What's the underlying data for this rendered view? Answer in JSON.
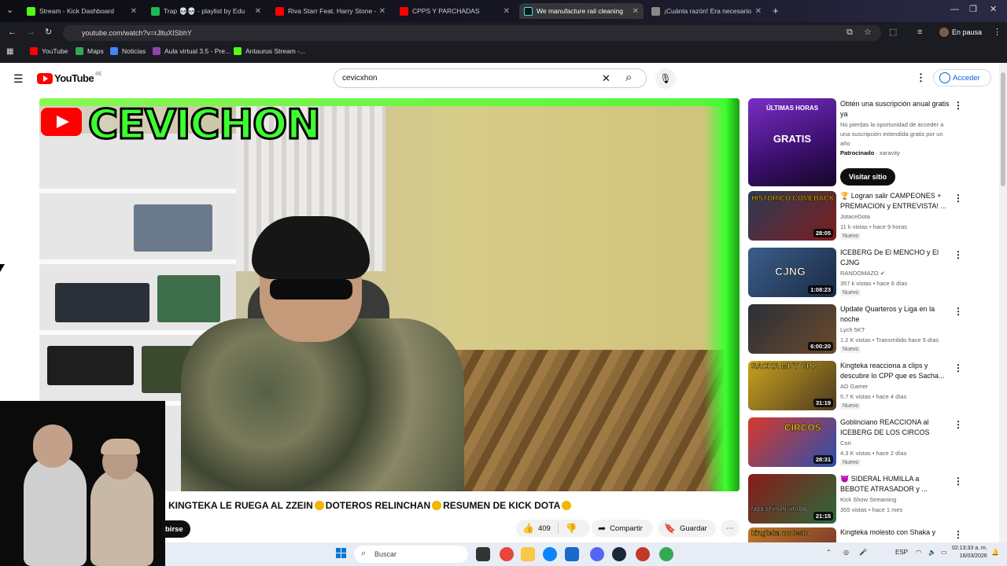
{
  "browser": {
    "tabs": [
      {
        "title": "Stream - Kick Dashboard",
        "color": "#53fc18"
      },
      {
        "title": "Trap 💀💀 - playlist by Edu",
        "color": "#1db954"
      },
      {
        "title": "Riva Starr Feat. Harry Stone - Hi",
        "color": "#ff0000"
      },
      {
        "title": "CPPS Y PARCHADAS",
        "color": "#ff0000"
      },
      {
        "title": "We manufacture rail cleaning",
        "color": "#111111"
      },
      {
        "title": "¡Cuánta razón! Era necesario p",
        "color": "#888888"
      }
    ],
    "url": "youtube.com/watch?v=rJltuXISbhY",
    "profile_label": "En pausa",
    "bookmarks": [
      {
        "label": "YouTube",
        "color": "#ff0000"
      },
      {
        "label": "Maps",
        "color": "#34a853"
      },
      {
        "label": "Noticias",
        "color": "#4285f4"
      },
      {
        "label": "Aula virtual 3.5 - Pre...",
        "color": "#8e44ad"
      },
      {
        "label": "Antaurus Stream -...",
        "color": "#53fc18"
      }
    ]
  },
  "youtube": {
    "logo_text": "YouTube",
    "region": "PE",
    "search_value": "cevicxhon",
    "signin_label": "Acceder"
  },
  "video": {
    "brand_overlay": "CEVICHON",
    "title_parts": [
      "KINGTEKA LE RUEGA AL ZZEIN",
      "DOTEROS RELINCHAN",
      "RESUMEN DE KICK DOTA"
    ],
    "subscribe_label": "birse",
    "likes": "409",
    "share_label": "Compartir",
    "save_label": "Guardar"
  },
  "ad": {
    "thumb_line1": "ÚLTIMAS HORAS",
    "thumb_line2": "GRATIS",
    "title": "Obtén una suscripción anual gratis ya",
    "desc": "No pierdas la oportunidad de acceder a una suscripción extendida gratis por un año",
    "sponsored": "Patrocinado",
    "advertiser": "xaravity",
    "cta": "Visitar sitio"
  },
  "recommendations": [
    {
      "title": "🏆 Logran salir CAMPEONES + PREMIACION y ENTREVISTA! ...",
      "channel": "JotaceDota",
      "meta": "11 k vistas • hace 9 horas",
      "badge": "Nuevo",
      "duration": "28:05",
      "thumb_text": "HISTORICO COMEBACK",
      "c1": "#2e3a55",
      "c2": "#7b1e1e"
    },
    {
      "title": "ICEBERG De El MENCHO y El CJNG",
      "channel": "RANDOMAZO",
      "meta": "357 k vistas • hace 6 días",
      "badge": "Nuevo",
      "duration": "1:08:23",
      "thumb_text": "CJNG",
      "c1": "#3b5e8a",
      "c2": "#1a2b44"
    },
    {
      "title": "Update Quarteros y Liga en la noche",
      "channel": "Lych 5KT",
      "meta": "1.2 K vistas • Transmitido hace 5 días",
      "badge": "Nuevo",
      "duration": "6:00:20",
      "thumb_text": "",
      "c1": "#2b2f3a",
      "c2": "#6b4a2a"
    },
    {
      "title": "Kingteka reacciona a clips y descubre lo CPP que es Sacha...",
      "channel": "AD Gamer",
      "meta": "5.7 K vistas • hace 4 días",
      "badge": "Nuevo",
      "duration": "31:19",
      "thumb_text": "SACHA MUY CPP",
      "c1": "#caa11e",
      "c2": "#4a3a20"
    },
    {
      "title": "Goblinciano REACCIONA al ICEBERG DE LOS CIRCOS",
      "channel": "Cori",
      "meta": "4.3 K vistas • hace 2 días",
      "badge": "Nuevo",
      "duration": "28:31",
      "thumb_text": "CIRCOS",
      "c1": "#d63a2a",
      "c2": "#2a4fb0"
    },
    {
      "title": "👿 SIDERAL HUMILLA a BEBOTE ATRASADOR y ...",
      "channel": "Kick Show Streaming",
      "meta": "355 vistas • hace 1 mes",
      "badge": "",
      "duration": "21:15",
      "thumb_text": "NO ESTÁS INVITADO",
      "c1": "#8a1a1a",
      "c2": "#2a6a3a"
    },
    {
      "title": "Kingteka molesto con Shaka y",
      "channel": "",
      "meta": "",
      "badge": "",
      "duration": "",
      "thumb_text": "kingteka molesto",
      "c1": "#c07a2a",
      "c2": "#6a2a2a"
    }
  ],
  "taskbar": {
    "search_placeholder": "Buscar",
    "lang": "ESP",
    "time": "02:13:33 a. m.",
    "date": "16/03/2026",
    "apps": [
      "#f4a300",
      "#333333",
      "#e8453c",
      "#f7c948",
      "#0b84ff",
      "#1b6ac9",
      "#5865f2",
      "#1b2838",
      "#c0392b",
      "#34a853"
    ]
  }
}
